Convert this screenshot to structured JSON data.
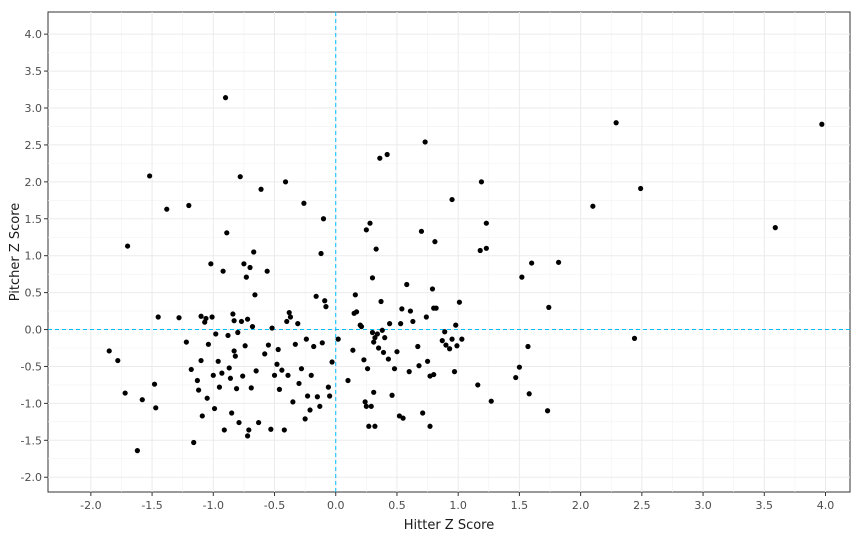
{
  "chart_data": {
    "type": "scatter",
    "title": "",
    "xlabel": "Hitter Z Score",
    "ylabel": "Pitcher Z Score",
    "xlim": [
      -2.35,
      4.2
    ],
    "ylim": [
      -2.2,
      4.3
    ],
    "xticks": [
      "-2.0",
      "-1.5",
      "-1.0",
      "-0.5",
      "0.0",
      "0.5",
      "1.0",
      "1.5",
      "2.0",
      "2.5",
      "3.0",
      "3.5",
      "4.0"
    ],
    "yticks": [
      "-2.0",
      "-1.5",
      "-1.0",
      "-0.5",
      "0.0",
      "0.5",
      "1.0",
      "1.5",
      "2.0",
      "2.5",
      "3.0",
      "3.5",
      "4.0"
    ],
    "grid": true,
    "reference_lines": {
      "x": 0,
      "y": 0,
      "color": "#00BFFF",
      "style": "dashed"
    },
    "point_color": "#000000",
    "points": [
      [
        -1.85,
        -0.29
      ],
      [
        -1.78,
        -0.42
      ],
      [
        -1.72,
        -0.86
      ],
      [
        -1.7,
        1.13
      ],
      [
        -1.62,
        -1.64
      ],
      [
        -1.58,
        -0.95
      ],
      [
        -1.52,
        2.08
      ],
      [
        -1.48,
        -0.74
      ],
      [
        -1.47,
        -1.06
      ],
      [
        -1.45,
        0.17
      ],
      [
        -1.38,
        1.63
      ],
      [
        -1.28,
        0.16
      ],
      [
        -1.22,
        -0.17
      ],
      [
        -1.2,
        1.68
      ],
      [
        -1.18,
        -0.54
      ],
      [
        -1.16,
        -1.53
      ],
      [
        -1.13,
        -0.69
      ],
      [
        -1.12,
        -0.82
      ],
      [
        -1.1,
        -0.42
      ],
      [
        -1.1,
        0.18
      ],
      [
        -1.09,
        -1.17
      ],
      [
        -1.07,
        0.1
      ],
      [
        -1.06,
        0.15
      ],
      [
        -1.05,
        -0.93
      ],
      [
        -1.04,
        -0.2
      ],
      [
        -1.02,
        0.89
      ],
      [
        -1.01,
        0.17
      ],
      [
        -1.0,
        -0.62
      ],
      [
        -0.99,
        -1.07
      ],
      [
        -0.98,
        -0.06
      ],
      [
        -0.96,
        -0.43
      ],
      [
        -0.95,
        -0.78
      ],
      [
        -0.93,
        -0.59
      ],
      [
        -0.92,
        0.79
      ],
      [
        -0.91,
        -1.36
      ],
      [
        -0.9,
        3.14
      ],
      [
        -0.89,
        1.31
      ],
      [
        -0.88,
        -0.08
      ],
      [
        -0.87,
        -0.52
      ],
      [
        -0.86,
        -0.66
      ],
      [
        -0.85,
        -1.13
      ],
      [
        -0.84,
        0.21
      ],
      [
        -0.83,
        -0.29
      ],
      [
        -0.83,
        0.12
      ],
      [
        -0.82,
        -0.36
      ],
      [
        -0.81,
        -0.8
      ],
      [
        -0.8,
        -0.04
      ],
      [
        -0.79,
        -1.26
      ],
      [
        -0.78,
        2.07
      ],
      [
        -0.77,
        0.11
      ],
      [
        -0.76,
        -0.63
      ],
      [
        -0.75,
        0.89
      ],
      [
        -0.74,
        -0.22
      ],
      [
        -0.73,
        0.71
      ],
      [
        -0.72,
        0.14
      ],
      [
        -0.72,
        -1.44
      ],
      [
        -0.71,
        -1.36
      ],
      [
        -0.7,
        0.84
      ],
      [
        -0.69,
        -0.79
      ],
      [
        -0.68,
        0.04
      ],
      [
        -0.67,
        1.05
      ],
      [
        -0.66,
        0.47
      ],
      [
        -0.65,
        -0.56
      ],
      [
        -0.63,
        -1.26
      ],
      [
        -0.61,
        1.9
      ],
      [
        -0.58,
        -0.33
      ],
      [
        -0.56,
        0.79
      ],
      [
        -0.55,
        -0.21
      ],
      [
        -0.53,
        -1.35
      ],
      [
        -0.52,
        0.02
      ],
      [
        -0.5,
        -0.62
      ],
      [
        -0.48,
        -0.47
      ],
      [
        -0.47,
        -0.27
      ],
      [
        -0.46,
        -0.81
      ],
      [
        -0.44,
        -0.55
      ],
      [
        -0.42,
        -1.36
      ],
      [
        -0.41,
        2.0
      ],
      [
        -0.4,
        0.11
      ],
      [
        -0.39,
        -0.62
      ],
      [
        -0.38,
        0.23
      ],
      [
        -0.37,
        0.17
      ],
      [
        -0.35,
        -0.98
      ],
      [
        -0.33,
        -0.2
      ],
      [
        -0.31,
        0.08
      ],
      [
        -0.3,
        -0.73
      ],
      [
        -0.28,
        -0.53
      ],
      [
        -0.26,
        1.71
      ],
      [
        -0.25,
        -1.21
      ],
      [
        -0.24,
        -0.13
      ],
      [
        -0.23,
        -0.9
      ],
      [
        -0.21,
        -1.09
      ],
      [
        -0.2,
        -0.62
      ],
      [
        -0.18,
        -0.23
      ],
      [
        -0.16,
        0.45
      ],
      [
        -0.15,
        -0.91
      ],
      [
        -0.13,
        -1.04
      ],
      [
        -0.12,
        1.03
      ],
      [
        -0.11,
        -0.18
      ],
      [
        -0.1,
        1.5
      ],
      [
        -0.09,
        0.39
      ],
      [
        -0.08,
        0.31
      ],
      [
        -0.06,
        -0.78
      ],
      [
        -0.05,
        -0.9
      ],
      [
        -0.03,
        -0.44
      ],
      [
        0.02,
        -0.13
      ],
      [
        0.1,
        -0.69
      ],
      [
        0.14,
        -0.28
      ],
      [
        0.15,
        0.22
      ],
      [
        0.16,
        0.47
      ],
      [
        0.17,
        0.24
      ],
      [
        0.2,
        0.06
      ],
      [
        0.21,
        0.04
      ],
      [
        0.23,
        -0.41
      ],
      [
        0.24,
        -0.98
      ],
      [
        0.25,
        -1.04
      ],
      [
        0.26,
        -0.53
      ],
      [
        0.25,
        1.35
      ],
      [
        0.27,
        -1.31
      ],
      [
        0.28,
        1.44
      ],
      [
        0.29,
        -1.04
      ],
      [
        0.3,
        -0.04
      ],
      [
        0.3,
        0.7
      ],
      [
        0.31,
        -0.85
      ],
      [
        0.31,
        -0.17
      ],
      [
        0.32,
        -0.11
      ],
      [
        0.32,
        -1.31
      ],
      [
        0.33,
        1.09
      ],
      [
        0.34,
        -0.06
      ],
      [
        0.35,
        -0.25
      ],
      [
        0.36,
        2.32
      ],
      [
        0.37,
        0.38
      ],
      [
        0.38,
        -0.01
      ],
      [
        0.39,
        -0.31
      ],
      [
        0.4,
        -0.11
      ],
      [
        0.42,
        2.37
      ],
      [
        0.43,
        -0.4
      ],
      [
        0.44,
        0.08
      ],
      [
        0.46,
        -0.89
      ],
      [
        0.48,
        -0.53
      ],
      [
        0.5,
        -0.3
      ],
      [
        0.52,
        -1.17
      ],
      [
        0.53,
        0.08
      ],
      [
        0.54,
        0.28
      ],
      [
        0.55,
        -1.2
      ],
      [
        0.58,
        0.61
      ],
      [
        0.6,
        -0.57
      ],
      [
        0.61,
        0.25
      ],
      [
        0.63,
        0.11
      ],
      [
        0.67,
        -0.23
      ],
      [
        0.68,
        -0.49
      ],
      [
        0.7,
        1.33
      ],
      [
        0.71,
        -1.13
      ],
      [
        0.73,
        2.54
      ],
      [
        0.74,
        0.17
      ],
      [
        0.75,
        -0.43
      ],
      [
        0.77,
        -0.63
      ],
      [
        0.77,
        -1.31
      ],
      [
        0.79,
        0.55
      ],
      [
        0.8,
        -0.61
      ],
      [
        0.8,
        0.29
      ],
      [
        0.81,
        1.19
      ],
      [
        0.82,
        0.29
      ],
      [
        0.87,
        -0.15
      ],
      [
        0.89,
        -0.03
      ],
      [
        0.9,
        -0.21
      ],
      [
        0.93,
        -0.26
      ],
      [
        0.95,
        -0.13
      ],
      [
        0.95,
        1.76
      ],
      [
        0.97,
        -0.57
      ],
      [
        0.98,
        0.06
      ],
      [
        0.99,
        -0.22
      ],
      [
        1.01,
        0.37
      ],
      [
        1.03,
        -0.13
      ],
      [
        1.16,
        -0.75
      ],
      [
        1.18,
        1.07
      ],
      [
        1.19,
        2.0
      ],
      [
        1.23,
        1.1
      ],
      [
        1.23,
        1.44
      ],
      [
        1.27,
        -0.97
      ],
      [
        1.47,
        -0.65
      ],
      [
        1.5,
        -0.51
      ],
      [
        1.52,
        0.71
      ],
      [
        1.57,
        -0.23
      ],
      [
        1.58,
        -0.87
      ],
      [
        1.6,
        0.9
      ],
      [
        1.73,
        -1.1
      ],
      [
        1.74,
        0.3
      ],
      [
        1.82,
        0.91
      ],
      [
        2.1,
        1.67
      ],
      [
        2.29,
        2.8
      ],
      [
        2.44,
        -0.12
      ],
      [
        2.49,
        1.91
      ],
      [
        3.59,
        1.38
      ],
      [
        3.97,
        2.78
      ]
    ]
  }
}
